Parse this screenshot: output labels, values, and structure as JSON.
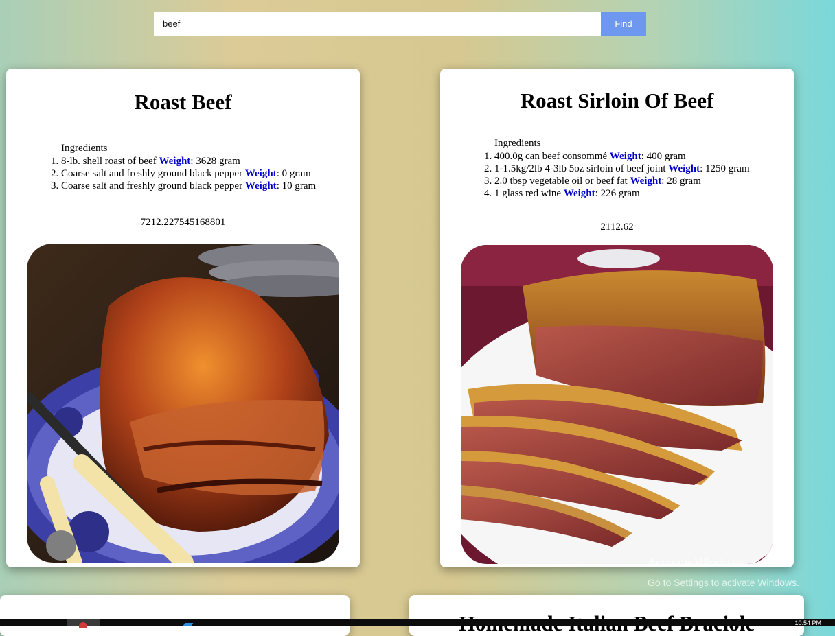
{
  "search": {
    "value": "beef",
    "button_label": "Find"
  },
  "recipes": [
    {
      "title": "Roast Beef",
      "ingredients_heading": "Ingredients",
      "ingredients": [
        {
          "name": "8-lb. shell roast of beef",
          "weight_label": "Weight",
          "weight_text": ": 3628 gram"
        },
        {
          "name": "Coarse salt and freshly ground black pepper",
          "weight_label": "Weight",
          "weight_text": ": 0 gram"
        },
        {
          "name": "Coarse salt and freshly ground black pepper",
          "weight_label": "Weight",
          "weight_text": ": 10 gram"
        }
      ],
      "total": "7212.227545168801"
    },
    {
      "title": "Roast Sirloin Of Beef",
      "ingredients_heading": "Ingredients",
      "ingredients": [
        {
          "name": "400.0g can beef consommé",
          "weight_label": "Weight",
          "weight_text": ": 400 gram"
        },
        {
          "name": "1-1.5kg/2lb 4-3lb 5oz sirloin of beef joint",
          "weight_label": "Weight",
          "weight_text": ": 1250 gram"
        },
        {
          "name": "2.0 tbsp vegetable oil or beef fat",
          "weight_label": "Weight",
          "weight_text": ": 28 gram"
        },
        {
          "name": "1 glass red wine",
          "weight_label": "Weight",
          "weight_text": ": 226 gram"
        }
      ],
      "total": "2112.62"
    },
    {
      "title": ""
    },
    {
      "title": "Homemade Italian Beef Braciole"
    }
  ],
  "overlay": {
    "watermark_title": "Activate Windows",
    "watermark_subtitle": "Go to Settings to activate Windows.",
    "clock": "10:54 PM"
  },
  "colors": {
    "find_button": "#6e97ef",
    "weight_label": "#0000cc"
  }
}
